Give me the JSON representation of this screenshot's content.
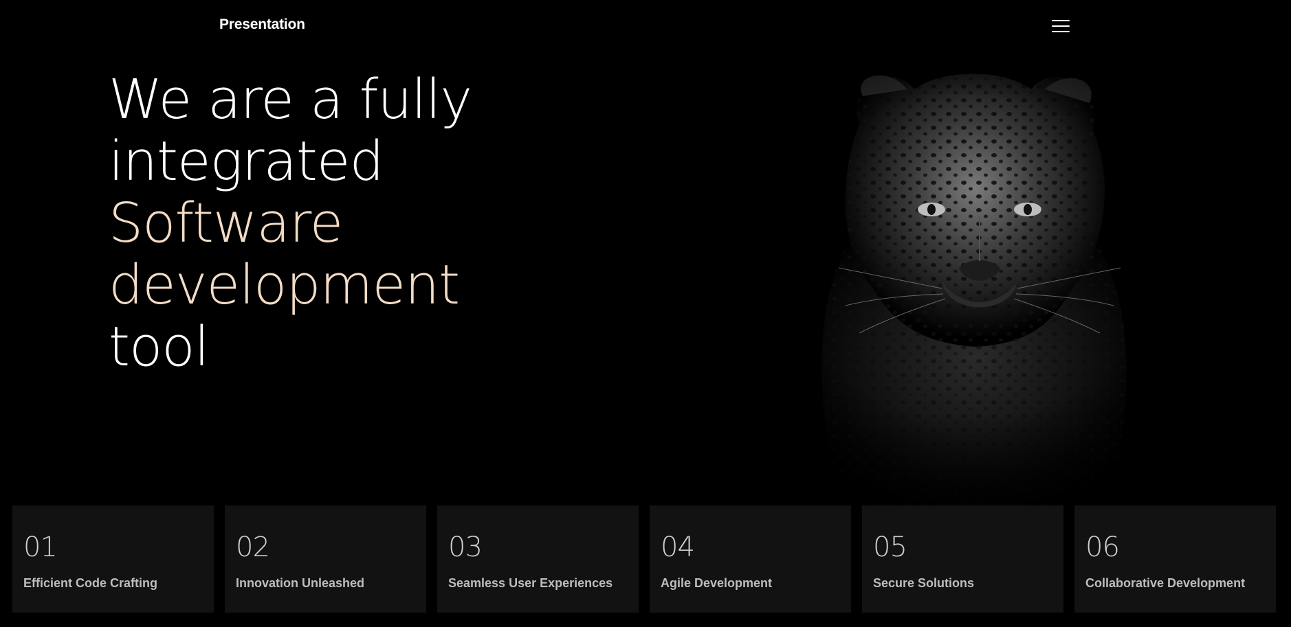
{
  "header": {
    "brand": "Presentation",
    "menu_icon": "hamburger-menu-icon"
  },
  "hero": {
    "lines": [
      "We are a fully",
      "integrated",
      "Software",
      "development",
      "tool"
    ],
    "accent_color": "#f3dcc6",
    "image_icon": "leopard-illustration"
  },
  "features": [
    {
      "number": "01",
      "title": "Efficient Code Crafting"
    },
    {
      "number": "02",
      "title": "Innovation Unleashed"
    },
    {
      "number": "03",
      "title": "Seamless User Experiences"
    },
    {
      "number": "04",
      "title": "Agile Development"
    },
    {
      "number": "05",
      "title": "Secure Solutions"
    },
    {
      "number": "06",
      "title": "Collaborative Development"
    }
  ],
  "colors": {
    "background": "#000000",
    "card_background": "#121212",
    "text": "#ffffff"
  }
}
